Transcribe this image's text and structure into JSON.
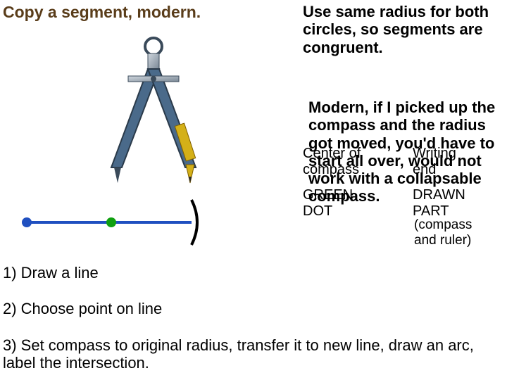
{
  "title": "Copy a segment, modern.",
  "top_right": "Use same radius for both circles, so segments are congruent.",
  "modern_text": "Modern, if I picked up the compass and the radius got moved, you'd have to start all over, would not work with a collapsable compass.",
  "labels": {
    "center": "Center of",
    "compass": "compass",
    "writing": "Writing",
    "end": "end",
    "green": "GREEN",
    "dot": "DOT",
    "drawn": "DRAWN",
    "part": "PART",
    "compass_note": "(compass",
    "ruler_note": "and ruler)"
  },
  "steps": {
    "s1": "1)  Draw a line",
    "s2": "2)  Choose point on line",
    "s3": "3)  Set compass to original radius, transfer it to new line, draw an arc, label the intersection."
  }
}
